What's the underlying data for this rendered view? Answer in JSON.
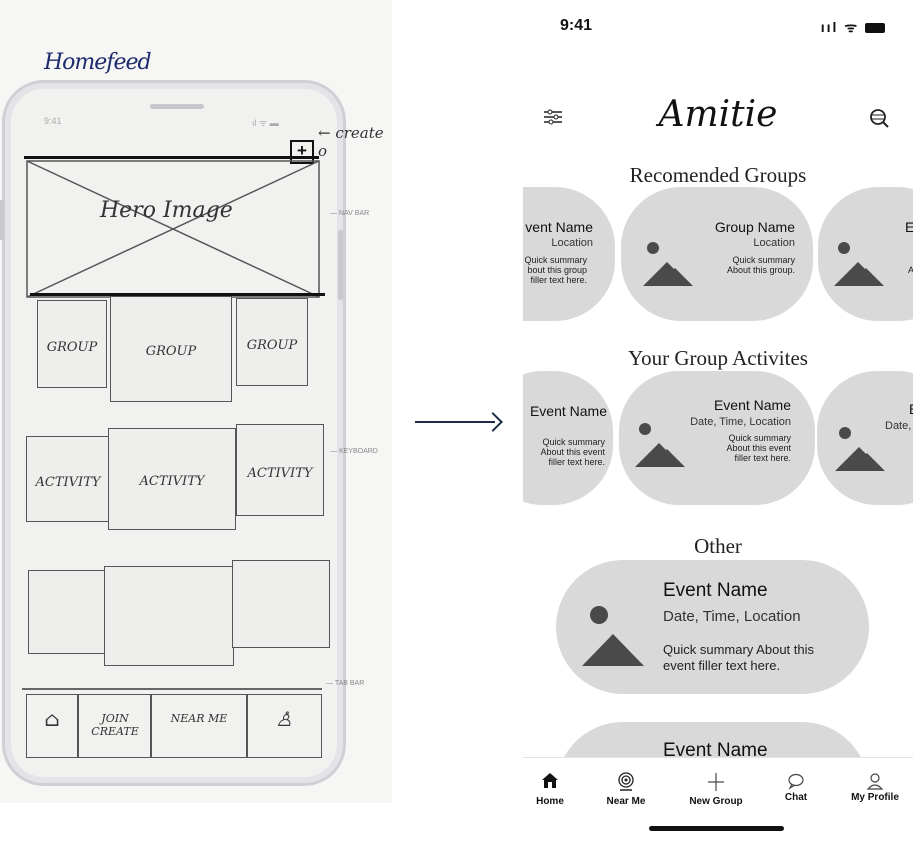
{
  "sketch": {
    "title": "Homefeed",
    "time": "9:41",
    "create_note": "create o",
    "hero_label": "Hero Image",
    "nav_bar_label": "NAV BAR",
    "keyboard_label": "KEYBOARD",
    "tab_bar_label": "TAB BAR",
    "groups": [
      "GROUP",
      "GROUP",
      "GROUP"
    ],
    "activities": [
      "ACTIVITY",
      "ACTIVITY",
      "ACTIVITY"
    ],
    "tabs": [
      "JOIN CREATE",
      "NEAR ME"
    ]
  },
  "status": {
    "time": "9:41"
  },
  "app": {
    "brand": "Amitie"
  },
  "sections": {
    "recommended": "Recomended Groups",
    "activities": "Your Group Activites",
    "other": "Other"
  },
  "recommended_cards": [
    {
      "title": "vent Name",
      "subtitle": "Location",
      "summary": "Quick summary\nbout this group\nfiller text here."
    },
    {
      "title": "Group Name",
      "subtitle": "Location",
      "summary": "Quick summary\nAbout this group."
    },
    {
      "title": "E",
      "subtitle": "",
      "summary": "A"
    }
  ],
  "activity_cards": [
    {
      "title": "Event Name",
      "subtitle": "",
      "summary": "Quick summary\nAbout this event\nfiller text here."
    },
    {
      "title": "Event Name",
      "subtitle": "Date, Time, Location",
      "summary": "Quick summary\nAbout this event\nfiller text here."
    },
    {
      "title": "E",
      "subtitle": "Date,",
      "summary": ""
    }
  ],
  "other_cards": [
    {
      "title": "Event Name",
      "subtitle": "Date, Time, Location",
      "summary": "Quick summary About this\nevent filler text here."
    },
    {
      "title": "Event Name"
    }
  ],
  "tabbar": [
    {
      "label": "Home",
      "icon": "home-icon"
    },
    {
      "label": "Near Me",
      "icon": "location-icon"
    },
    {
      "label": "New Group",
      "icon": "plus-icon"
    },
    {
      "label": "Chat",
      "icon": "chat-icon"
    },
    {
      "label": "My Profile",
      "icon": "person-icon"
    }
  ]
}
